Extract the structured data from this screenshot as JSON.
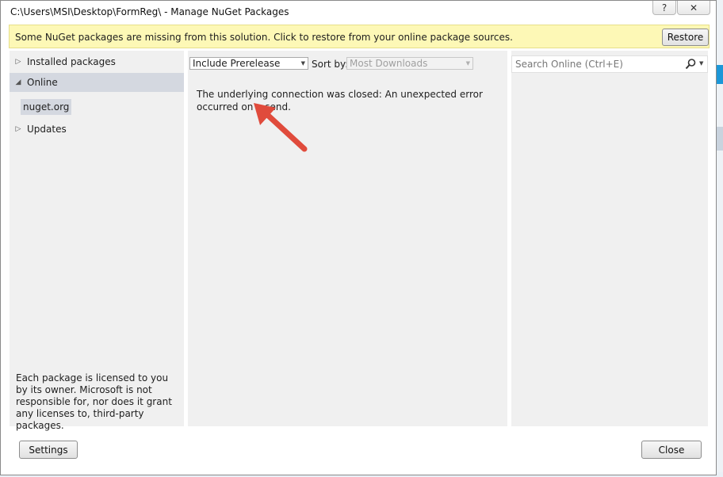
{
  "window": {
    "title": "C:\\Users\\MSI\\Desktop\\FormReg\\ - Manage NuGet Packages",
    "help_label": "?",
    "close_label": "✕"
  },
  "infobar": {
    "message": "Some NuGet packages are missing from this solution. Click to restore from your online package sources.",
    "restore_label": "Restore"
  },
  "sidebar": {
    "items": [
      {
        "label": "Installed packages",
        "expanded": false
      },
      {
        "label": "Online",
        "expanded": true
      },
      {
        "label": "Updates",
        "expanded": false
      }
    ],
    "sub_items": [
      {
        "label": "nuget.org"
      }
    ],
    "license_text": "Each package is licensed to you by its owner. Microsoft is not responsible for, nor does it grant any licenses to, third-party packages."
  },
  "toolbar": {
    "prerelease_value": "Include Prerelease",
    "sortby_label": "Sort by:",
    "sortby_value": "Most Downloads"
  },
  "main": {
    "error_message": "The underlying connection was closed: An unexpected error occurred on a send."
  },
  "search": {
    "placeholder": "Search Online (Ctrl+E)"
  },
  "footer": {
    "settings_label": "Settings",
    "close_label": "Close"
  },
  "colors": {
    "infobar_bg": "#fdf8b6",
    "annotation_arrow": "#e04b3c"
  }
}
